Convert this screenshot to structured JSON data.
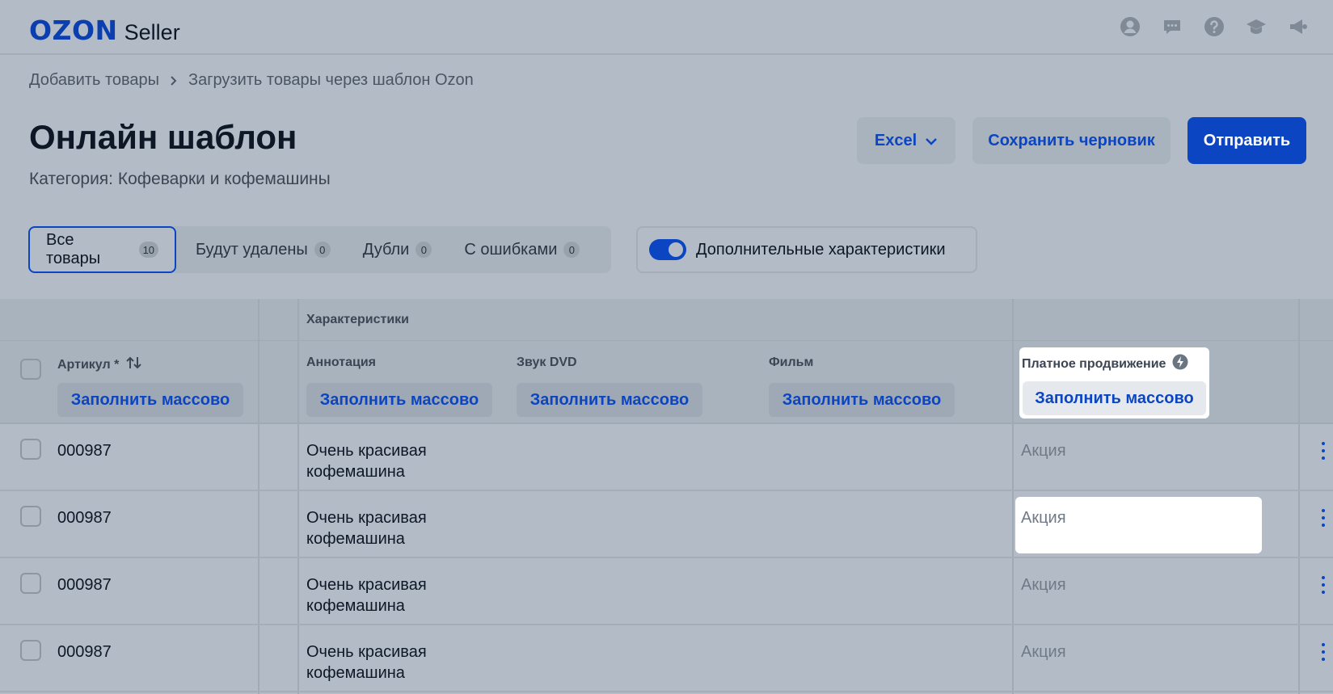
{
  "header": {
    "logo_brand": "OZON",
    "logo_product": "Seller",
    "icons": [
      "user-icon",
      "chat-icon",
      "help-icon",
      "education-icon",
      "announcement-icon"
    ]
  },
  "breadcrumb": {
    "items": [
      "Добавить товары",
      "Загрузить товары через шаблон Ozon"
    ]
  },
  "page": {
    "title": "Онлайн шаблон",
    "subtitle": "Категория: Кофеварки и кофемашины"
  },
  "actions": {
    "excel_label": "Excel",
    "draft_label": "Сохранить черновик",
    "send_label": "Отправить"
  },
  "tabs": [
    {
      "label": "Все товары",
      "count": "10",
      "active": true
    },
    {
      "label": "Будут удалены",
      "count": "0",
      "active": false
    },
    {
      "label": "Дубли",
      "count": "0",
      "active": false
    },
    {
      "label": "С ошибками",
      "count": "0",
      "active": false
    }
  ],
  "toggle": {
    "label": "Дополнительные характеристики",
    "on": true
  },
  "table": {
    "group_label": "Характеристики",
    "columns": {
      "article": "Артикул *",
      "annotation": "Аннотация",
      "dvd_sound": "Звук DVD",
      "film": "Фильм",
      "promotion": "Платное продвижение"
    },
    "fill_label": "Заполнить массово",
    "rows": [
      {
        "article": "000987",
        "annotation": "Очень красивая кофемашина",
        "promotion": "Акция"
      },
      {
        "article": "000987",
        "annotation": "Очень красивая кофемашина",
        "promotion": "Акция"
      },
      {
        "article": "000987",
        "annotation": "Очень красивая кофемашина",
        "promotion": "Акция"
      },
      {
        "article": "000987",
        "annotation": "Очень красивая кофемашина",
        "promotion": "Акция"
      }
    ]
  },
  "colors": {
    "accent": "#0b45c2",
    "background": "#b3bcc6",
    "highlight": "#ffffff"
  }
}
